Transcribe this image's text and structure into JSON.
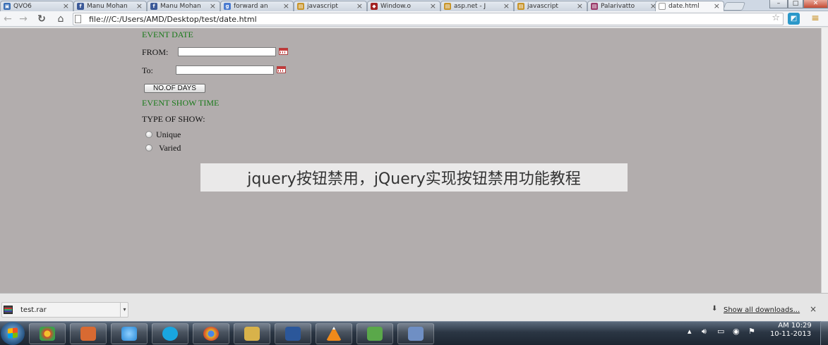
{
  "browser": {
    "tabs": [
      {
        "label": "QVO6",
        "icon": "qvo6-icon",
        "color": "#3a6fb5"
      },
      {
        "label": "Manu Mohan",
        "icon": "facebook-icon",
        "color": "#3b5998"
      },
      {
        "label": "Manu Mohan",
        "icon": "facebook-icon",
        "color": "#3b5998"
      },
      {
        "label": "forward an",
        "icon": "google-icon",
        "color": "#4a7bd0"
      },
      {
        "label": "javascript",
        "icon": "page-icon",
        "color": "#c8952a"
      },
      {
        "label": "Window.o",
        "icon": "mozilla-icon",
        "color": "#a32121"
      },
      {
        "label": "asp.net - J",
        "icon": "page-icon",
        "color": "#c8952a"
      },
      {
        "label": "javascript",
        "icon": "page-icon",
        "color": "#c8952a"
      },
      {
        "label": "Palarivatto",
        "icon": "page-icon",
        "color": "#9b3b6b"
      },
      {
        "label": "date.html",
        "icon": "document-icon",
        "color": "#ffffff",
        "active": true
      }
    ],
    "tab_close": "×",
    "window_controls": {
      "minimize": "–",
      "maximize": "□",
      "close": "✕"
    },
    "nav": {
      "back": "←",
      "forward": "→",
      "reload": "↻",
      "home": "⌂"
    },
    "address": "file:///C:/Users/AMD/Desktop/test/date.html",
    "star": "☆",
    "menu": "≡"
  },
  "form": {
    "event_date_heading": "EVENT DATE",
    "from_label": "FROM:",
    "from_value": "",
    "to_label": "To:",
    "to_value": "",
    "days_button": "NO.OF DAYS",
    "event_show_time_heading": "EVENT SHOW TIME",
    "type_of_show_label": "TYPE OF SHOW:",
    "options": [
      "Unique",
      "Varied"
    ]
  },
  "watermark": {
    "text": "jquery按钮禁用，jQuery实现按钮禁用功能教程"
  },
  "downloads": {
    "file_name": "test.rar",
    "show_all": "Show all downloads...",
    "close": "×"
  },
  "taskbar": {
    "apps": [
      {
        "name": "chrome-pinned",
        "color": "#d64a2c"
      },
      {
        "name": "media-player",
        "color": "#d86a32"
      },
      {
        "name": "internet-explorer",
        "color": "#2a8ad8"
      },
      {
        "name": "skype",
        "color": "#19a6e0"
      },
      {
        "name": "chrome",
        "color": "#e2b52a"
      },
      {
        "name": "file-explorer",
        "color": "#d8b24a"
      },
      {
        "name": "word",
        "color": "#2b579a"
      },
      {
        "name": "vlc",
        "color": "#f08a1a"
      },
      {
        "name": "chart-app",
        "color": "#5aa84a"
      },
      {
        "name": "paint",
        "color": "#6f8fc4"
      }
    ],
    "time": "AM 10:29",
    "date": "10-11-2013"
  }
}
